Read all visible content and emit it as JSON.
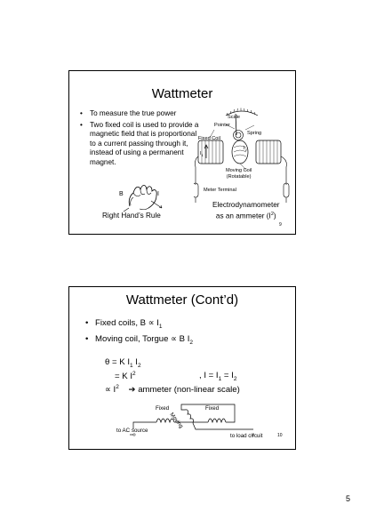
{
  "slide1": {
    "title": "Wattmeter",
    "bullets": [
      "To measure the true power",
      "Two fixed coil is used to provide a magnetic field that is proportional to a current passing through it, instead of using a permanent magnet."
    ],
    "hand_caption": "Right Hand’s Rule",
    "hand_labels": {
      "b": "B",
      "i": "I"
    },
    "diagram_labels": {
      "scale": "Scale",
      "pointer": "Pointer",
      "spring": "Spring",
      "fixed_coil": "Fixed Coil",
      "i1": "I",
      "i1_sub": "1",
      "i2": "I",
      "i2_sub": "2",
      "moving_coil": "Moving Coil",
      "moving_coil_sub": "(Rotatable)",
      "meter_terminal": "Meter Terminal"
    },
    "caption_line1": "Electrodynamometer",
    "caption_line2_pre": "as an ammeter (I",
    "caption_line2_sup": "2",
    "caption_line2_post": ")",
    "slide_number": "9"
  },
  "slide2": {
    "title": "Wattmeter (Cont’d)",
    "bullet1_pre": "Fixed coils, B ∝ I",
    "bullet1_sub": "1",
    "bullet2_pre": "Moving coil, Torgue  ∝ B I",
    "bullet2_sub": "2",
    "eq1": {
      "a": "θ = K I",
      "s1": "1",
      "b": " I",
      "s2": "2"
    },
    "eq2": {
      "a": "= K I",
      "sup": "2"
    },
    "eq2_right": {
      "a": ", I = I",
      "s1": "1",
      "b": " = I",
      "s2": "2"
    },
    "eq3": {
      "a": "∝ I",
      "sup": "2",
      "arrow": "➔",
      "b": " ammeter (non-linear scale)"
    },
    "circuit_labels": {
      "fixed_left": "Fixed",
      "fixed_right": "Fixed",
      "moving": "Moving",
      "ac_source": "to AC source",
      "load_circuit": "to load circuit"
    },
    "slide_number": "10"
  },
  "page_number": "5"
}
